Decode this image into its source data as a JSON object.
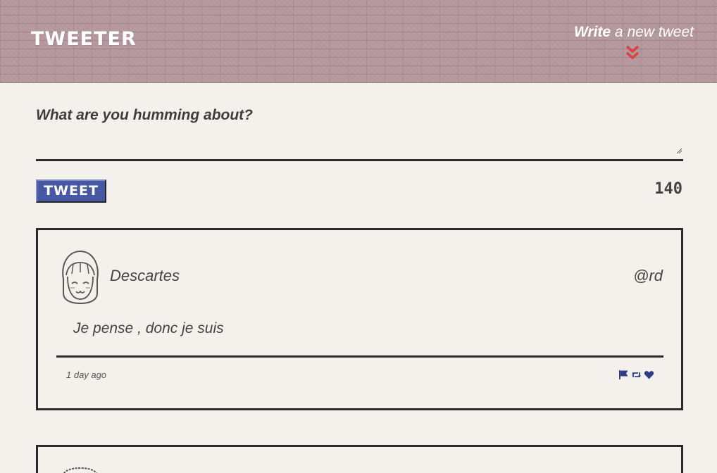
{
  "header": {
    "logo": "TWEETER",
    "compose_toggle": {
      "bold": "Write",
      "rest": " a new tweet"
    }
  },
  "compose": {
    "question": "What are you humming about?",
    "placeholder": "",
    "button_label": "TWEET",
    "counter": "140"
  },
  "tweets": [
    {
      "name": "Descartes",
      "handle": "@rd",
      "content": "Je pense , donc je suis",
      "timestamp": "1 day ago",
      "actions": [
        "flag-icon",
        "retweet-icon",
        "heart-icon"
      ]
    }
  ],
  "colors": {
    "header_bg": "#b3979c",
    "page_bg": "#f4f1ed",
    "button_bg": "#4657a3",
    "accent_red": "#d9423f",
    "action_blue": "#2f3f86"
  }
}
